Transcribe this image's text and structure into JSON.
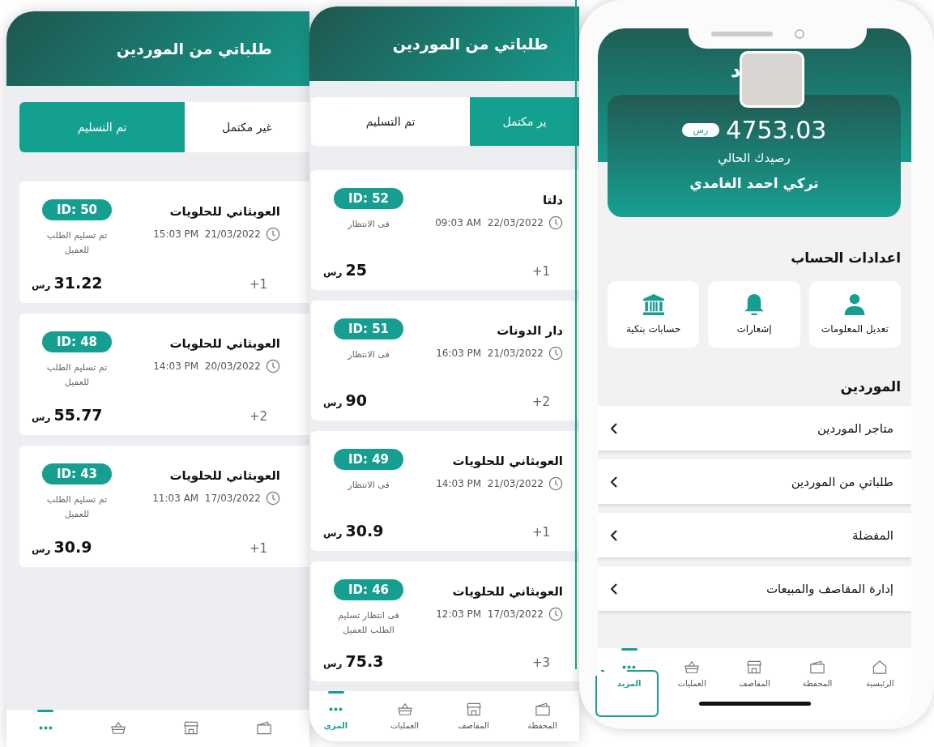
{
  "phones": [
    {
      "kind": "profile",
      "title_fragment": "د",
      "balance": "4753.03",
      "currency": "رس",
      "balance_label": "رصيدك الحالي",
      "user_name": "تركي احمد الغامدي",
      "settings_heading": "اعدادات الحساب",
      "settings": [
        {
          "kind": "person",
          "label": "تعديل المعلومات"
        },
        {
          "kind": "bell",
          "label": "إشعارات"
        },
        {
          "kind": "bank",
          "label": "حسابات بنكية"
        }
      ],
      "suppliers_heading": "الموردين",
      "menu": [
        {
          "label": "متاجر الموردين"
        },
        {
          "label": "طلباتي من الموردين"
        },
        {
          "label": "المفضلة"
        },
        {
          "label": "إدارة المقاصف والمبيعات"
        }
      ],
      "nav": [
        {
          "kind": "home",
          "label": "الرئيسية",
          "selected": false
        },
        {
          "kind": "wallet",
          "label": "المحفظة",
          "selected": false
        },
        {
          "kind": "store",
          "label": "المقاصف",
          "selected": false
        },
        {
          "kind": "basket",
          "label": "العمليات",
          "selected": false
        },
        {
          "kind": "more",
          "label": "المزيد",
          "selected": true
        }
      ]
    },
    {
      "kind": "orders",
      "title": "طلباتي من الموردين",
      "tabs": [
        {
          "label": "ير مكتمل",
          "selected": true
        },
        {
          "label": "تم التسليم",
          "selected": false
        }
      ],
      "orders": [
        {
          "id": "ID: 52",
          "store": "دلتا",
          "time": "09:03 AM  22/03/2022",
          "status": "فى الانتظار",
          "count": "+1",
          "amount": "25",
          "currency": "رس"
        },
        {
          "id": "ID: 51",
          "store": "دار الدونات",
          "time": "16:03 PM  21/03/2022",
          "status": "فى الانتظار",
          "count": "+2",
          "amount": "90",
          "currency": "رس"
        },
        {
          "id": "ID: 49",
          "store": "العوبثاني للحلويات",
          "time": "14:03 PM  21/03/2022",
          "status": "فى الانتظار",
          "count": "+1",
          "amount": "30.9",
          "currency": "رس"
        },
        {
          "id": "ID: 46",
          "store": "العوبثاني للحلويات",
          "time": "12:03 PM  17/03/2022",
          "status": "فى انتظار تسليم الطلب للعميل",
          "count": "+3",
          "amount": "75.3",
          "currency": "رس"
        }
      ],
      "nav": [
        {
          "kind": "wallet",
          "label": "المحفظة",
          "selected": false
        },
        {
          "kind": "store",
          "label": "المقاصف",
          "selected": false
        },
        {
          "kind": "basket",
          "label": "العمليات",
          "selected": false
        },
        {
          "kind": "more",
          "label": "المزي",
          "selected": true
        }
      ]
    },
    {
      "kind": "orders",
      "title": "طلباتي من الموردين",
      "tabs": [
        {
          "label": "غير مكتمل",
          "selected": false
        },
        {
          "label": "تم التسليم",
          "selected": true
        }
      ],
      "orders": [
        {
          "id": "ID: 50",
          "store": "العوبثاني للحلويات",
          "time": "15:03 PM  21/03/2022",
          "status": "تم تسليم الطلب للعميل",
          "count": "+1",
          "amount": "31.22",
          "currency": "رس"
        },
        {
          "id": "ID: 48",
          "store": "العوبثاني للحلويات",
          "time": "14:03 PM  20/03/2022",
          "status": "تم تسليم الطلب للعميل",
          "count": "+2",
          "amount": "55.77",
          "currency": "رس"
        },
        {
          "id": "ID: 43",
          "store": "العوبثاني للحلويات",
          "time": "11:03 AM  17/03/2022",
          "status": "تم تسليم الطلب للعميل",
          "count": "+1",
          "amount": "30.9",
          "currency": "رس"
        }
      ],
      "nav": [
        {
          "kind": "wallet",
          "selected": false
        },
        {
          "kind": "store",
          "selected": false
        },
        {
          "kind": "basket",
          "selected": false
        },
        {
          "kind": "more",
          "selected": true
        }
      ]
    }
  ]
}
